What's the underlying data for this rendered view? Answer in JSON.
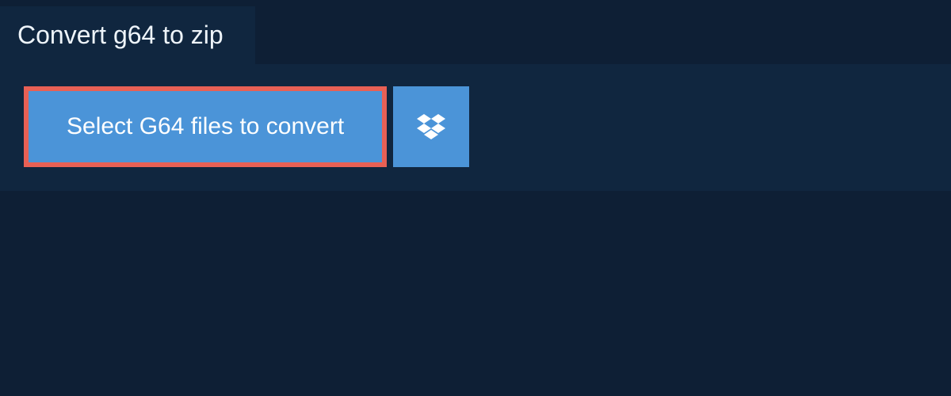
{
  "header": {
    "title": "Convert g64 to zip"
  },
  "actions": {
    "select_files_label": "Select G64 files to convert"
  },
  "colors": {
    "background": "#0e1f35",
    "panel": "#10263f",
    "button": "#4b94d8",
    "highlight_border": "#e86055",
    "text_light": "#eef4fa",
    "text_white": "#ffffff"
  }
}
